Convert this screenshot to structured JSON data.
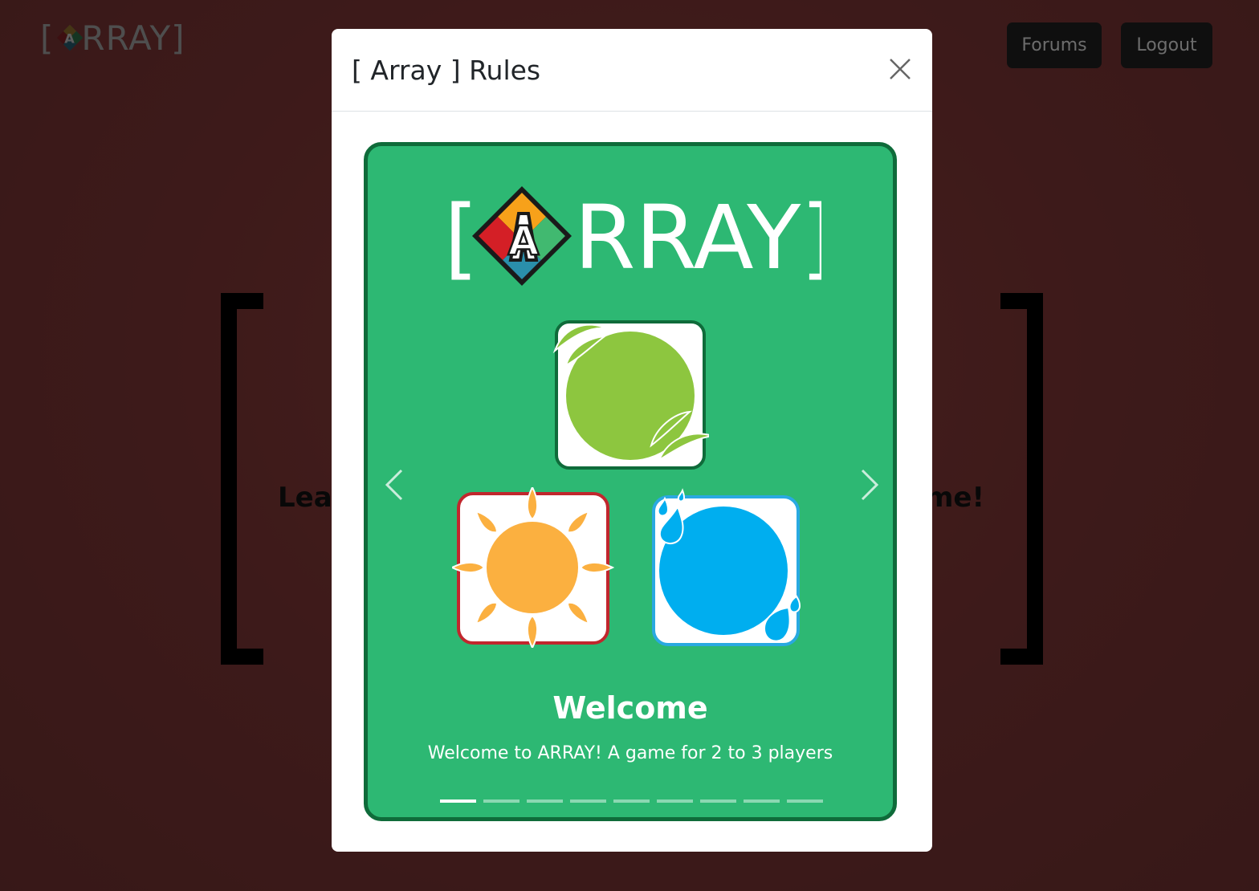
{
  "background": {
    "logo_bracket_open": "[",
    "logo_text": "RRAY]",
    "nav": {
      "forums_label": "Forums",
      "logout_label": "Logout"
    },
    "tagline_left": "Lear",
    "tagline_right": "me!"
  },
  "modal": {
    "title": "[ Array ] Rules",
    "close_icon": "close-icon",
    "logo": {
      "bracket_open": "[",
      "letter": "A",
      "text": "RRAY]"
    },
    "slide": {
      "title": "Welcome",
      "text": "Welcome to ARRAY! A game for 2 to 3 players"
    },
    "indicator_count": 9,
    "active_indicator": 0,
    "tiles": [
      "leaf-tile",
      "sun-tile",
      "water-tile"
    ]
  },
  "colors": {
    "card_green": "#2db873",
    "card_border": "#0f6b3a",
    "leaf": "#8dc63f",
    "sun": "#fbb040",
    "water": "#00aeef",
    "diamond_red": "#d41f26",
    "diamond_orange": "#f7a11a",
    "diamond_green": "#41b970",
    "diamond_blue": "#2a8fab"
  }
}
